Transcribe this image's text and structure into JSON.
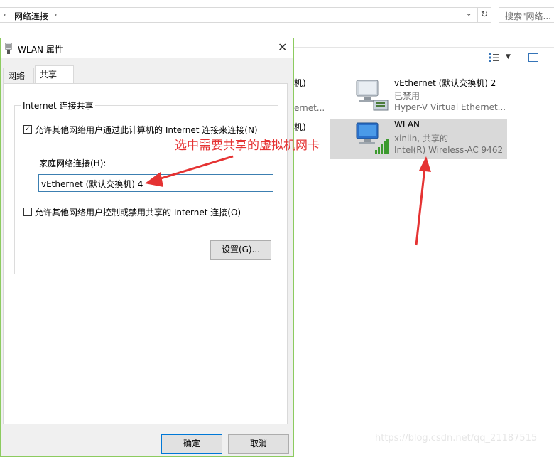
{
  "explorer": {
    "breadcrumb": "网络连接",
    "search_placeholder": "搜索\"网络...",
    "adapters": [
      {
        "name": "vEthernet (默认交换机) 2",
        "status": "已禁用",
        "description": "Hyper-V Virtual Ethernet...",
        "icon": "ethernet-adapter-icon"
      },
      {
        "name": "WLAN",
        "status": "xinlin, 共享的",
        "description": "Intel(R) Wireless-AC 9462",
        "icon": "wifi-adapter-icon"
      }
    ],
    "partial_left": {
      "a_line1": "机)",
      "a_line3": "ernet...",
      "b_line1": "机)"
    }
  },
  "dialog": {
    "title": "WLAN 属性",
    "tabs": [
      "网络",
      "共享"
    ],
    "group_title": "Internet 连接共享",
    "allow_share_label": "允许其他网络用户通过此计算机的 Internet 连接来连接(N)",
    "allow_share_checked": true,
    "home_network_label": "家庭网络连接(H):",
    "home_network_value": "vEthernet (默认交换机) 4",
    "allow_control_label": "允许其他网络用户控制或禁用共享的 Internet 连接(O)",
    "allow_control_checked": false,
    "settings_button": "设置(G)...",
    "ok_button": "确定",
    "cancel_button": "取消"
  },
  "annotation": {
    "text": "选中需要共享的虚拟机网卡",
    "color": "#e53333"
  },
  "watermark": "https://blog.csdn.net/qq_21187515"
}
